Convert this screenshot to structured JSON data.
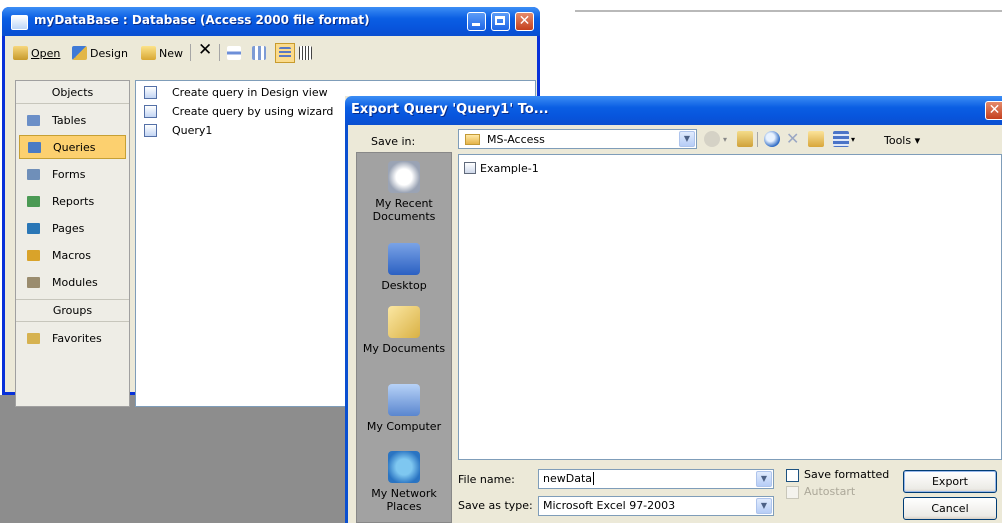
{
  "db_window": {
    "title": "myDataBase : Database (Access 2000 file format)",
    "toolbar": {
      "open": "Open",
      "design": "Design",
      "new": "New"
    },
    "nav": {
      "objects_header": "Objects",
      "items": [
        {
          "label": "Tables",
          "icon": "tables-icon",
          "color": "#6b8fc7"
        },
        {
          "label": "Queries",
          "icon": "queries-icon",
          "color": "#4a7bc4",
          "selected": true
        },
        {
          "label": "Forms",
          "icon": "forms-icon",
          "color": "#6f8fb9"
        },
        {
          "label": "Reports",
          "icon": "reports-icon",
          "color": "#4b9a54"
        },
        {
          "label": "Pages",
          "icon": "pages-icon",
          "color": "#2a77b6"
        },
        {
          "label": "Macros",
          "icon": "macros-icon",
          "color": "#d9a32a"
        },
        {
          "label": "Modules",
          "icon": "modules-icon",
          "color": "#9a8c6e"
        }
      ],
      "groups_header": "Groups",
      "groups": [
        {
          "label": "Favorites",
          "icon": "favorites-folder-icon",
          "color": "#d6b250"
        }
      ]
    },
    "list": [
      {
        "label": "Create query in Design view"
      },
      {
        "label": "Create query by using wizard"
      },
      {
        "label": "Query1"
      }
    ]
  },
  "dialog": {
    "title": "Export Query 'Query1' To...",
    "save_in_label": "Save in:",
    "save_in_value": "MS-Access",
    "tools_label": "Tools",
    "places": [
      {
        "label_lines": [
          "My Recent",
          "Documents"
        ],
        "icon": "my-recent-documents-icon"
      },
      {
        "label_lines": [
          "Desktop"
        ],
        "icon": "desktop-icon"
      },
      {
        "label_lines": [
          "My Documents"
        ],
        "icon": "my-documents-icon"
      },
      {
        "label_lines": [
          "My Computer"
        ],
        "icon": "my-computer-icon"
      },
      {
        "label_lines": [
          "My Network",
          "Places"
        ],
        "icon": "my-network-places-icon"
      }
    ],
    "files": [
      {
        "name": "Example-1"
      }
    ],
    "file_name_label": "File name:",
    "file_name_value": "newData",
    "save_as_type_label": "Save as type:",
    "save_as_type_value": "Microsoft Excel 97-2003",
    "save_formatted_label": "Save formatted",
    "autostart_label": "Autostart",
    "export_button": "Export",
    "cancel_button": "Cancel"
  }
}
